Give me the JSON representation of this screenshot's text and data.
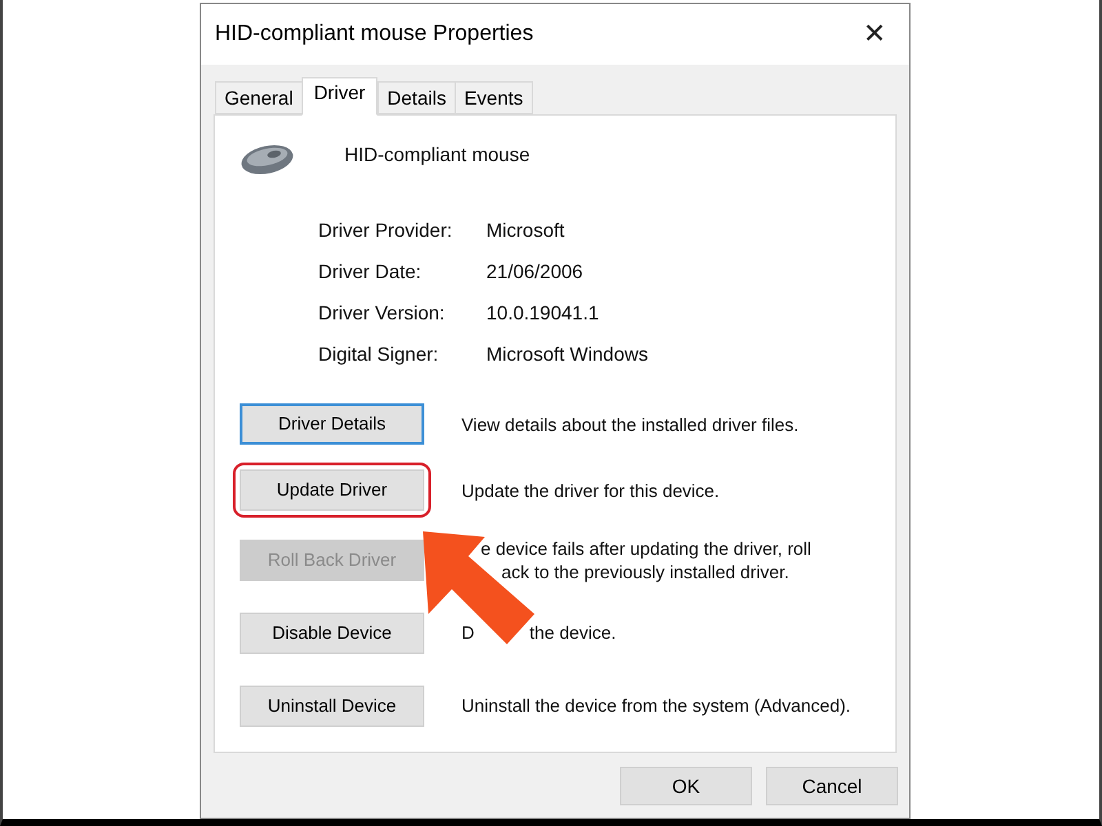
{
  "window": {
    "title": "HID-compliant mouse Properties",
    "close": "✕"
  },
  "tabs": [
    {
      "label": "General",
      "selected": false
    },
    {
      "label": "Driver",
      "selected": true
    },
    {
      "label": "Details",
      "selected": false
    },
    {
      "label": "Events",
      "selected": false
    }
  ],
  "device_name": "HID-compliant mouse",
  "properties": [
    {
      "label": "Driver Provider:",
      "value": "Microsoft"
    },
    {
      "label": "Driver Date:",
      "value": "21/06/2006"
    },
    {
      "label": "Driver Version:",
      "value": "10.0.19041.1"
    },
    {
      "label": "Digital Signer:",
      "value": "Microsoft Windows"
    }
  ],
  "actions": [
    {
      "button": "Driver Details",
      "disabled": false,
      "focused": true,
      "highlighted": false,
      "description": [
        "View details about the installed driver files."
      ]
    },
    {
      "button": "Update Driver",
      "disabled": false,
      "focused": false,
      "highlighted": true,
      "description": [
        "Update the driver for this device."
      ]
    },
    {
      "button": "Roll Back Driver",
      "disabled": true,
      "focused": false,
      "highlighted": false,
      "description": [
        "e device fails after updating the driver, roll",
        "ack to the previously installed driver."
      ]
    },
    {
      "button": "Disable Device",
      "disabled": false,
      "focused": false,
      "highlighted": false,
      "description": [
        "D",
        "the device."
      ]
    },
    {
      "button": "Uninstall Device",
      "disabled": false,
      "focused": false,
      "highlighted": false,
      "description": [
        "Uninstall the device from the system (Advanced)."
      ]
    }
  ],
  "footer_buttons": [
    "OK",
    "Cancel"
  ]
}
